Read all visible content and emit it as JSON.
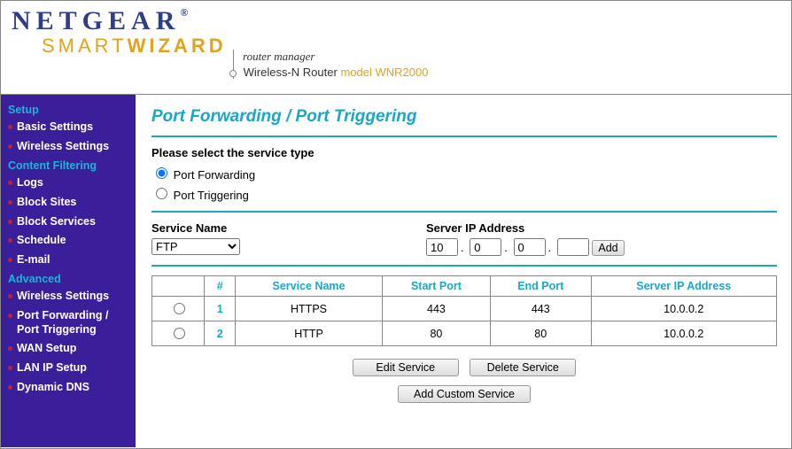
{
  "header": {
    "brand": "NETGEAR",
    "reg": "®",
    "smart": "SMART",
    "wizard": "WIZARD",
    "manager": "router manager",
    "router_desc": "Wireless-N Router",
    "model_label": "model WNR2000"
  },
  "sidebar": {
    "sections": [
      {
        "title": "Setup",
        "items": [
          "Basic Settings",
          "Wireless Settings"
        ]
      },
      {
        "title": "Content Filtering",
        "items": [
          "Logs",
          "Block Sites",
          "Block Services",
          "Schedule",
          "E-mail"
        ]
      },
      {
        "title": "Advanced",
        "items": [
          "Wireless Settings",
          "Port Forwarding / Port Triggering",
          "WAN Setup",
          "LAN IP Setup",
          "Dynamic DNS"
        ]
      }
    ]
  },
  "page": {
    "title": "Port Forwarding / Port Triggering",
    "service_type_prompt": "Please select the service type",
    "radio_forwarding": "Port Forwarding",
    "radio_triggering": "Port Triggering",
    "service_name_label": "Service Name",
    "service_name_value": "FTP",
    "server_ip_label": "Server IP Address",
    "ip": {
      "o1": "10",
      "o2": "0",
      "o3": "0",
      "o4": ""
    },
    "add_btn": "Add",
    "table": {
      "headers": {
        "sel": "",
        "num": "#",
        "svc": "Service Name",
        "start": "Start Port",
        "end": "End Port",
        "ip": "Server IP Address"
      },
      "rows": [
        {
          "num": "1",
          "svc": "HTTPS",
          "start": "443",
          "end": "443",
          "ip": "10.0.0.2"
        },
        {
          "num": "2",
          "svc": "HTTP",
          "start": "80",
          "end": "80",
          "ip": "10.0.0.2"
        }
      ]
    },
    "edit_btn": "Edit Service",
    "delete_btn": "Delete Service",
    "custom_btn": "Add Custom Service"
  }
}
